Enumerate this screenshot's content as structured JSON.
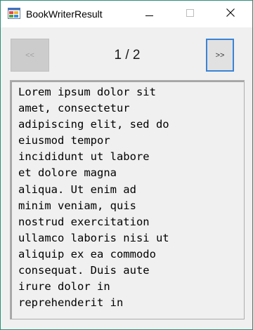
{
  "window": {
    "title": "BookWriterResult",
    "icon": "windows-form-icon"
  },
  "title_buttons": {
    "minimize_icon": "minimize-icon",
    "maximize_icon": "maximize-icon",
    "close_icon": "close-icon"
  },
  "toolbar": {
    "prev_label": "<<",
    "next_label": ">>",
    "page_indicator": "1 / 2"
  },
  "content": {
    "text": "Lorem ipsum dolor sit\namet, consectetur\nadipiscing elit, sed do\neiusmod tempor\nincididunt ut labore\net dolore magna\naliqua. Ut enim ad\nminim veniam, quis\nnostrud exercitation\nullamco laboris nisi ut\naliquip ex ea commodo\nconsequat. Duis aute\nirure dolor in\nreprehenderit in"
  },
  "colors": {
    "accent": "#3a84d6",
    "window_border": "#2b8f7a",
    "background": "#f0f0f0"
  }
}
